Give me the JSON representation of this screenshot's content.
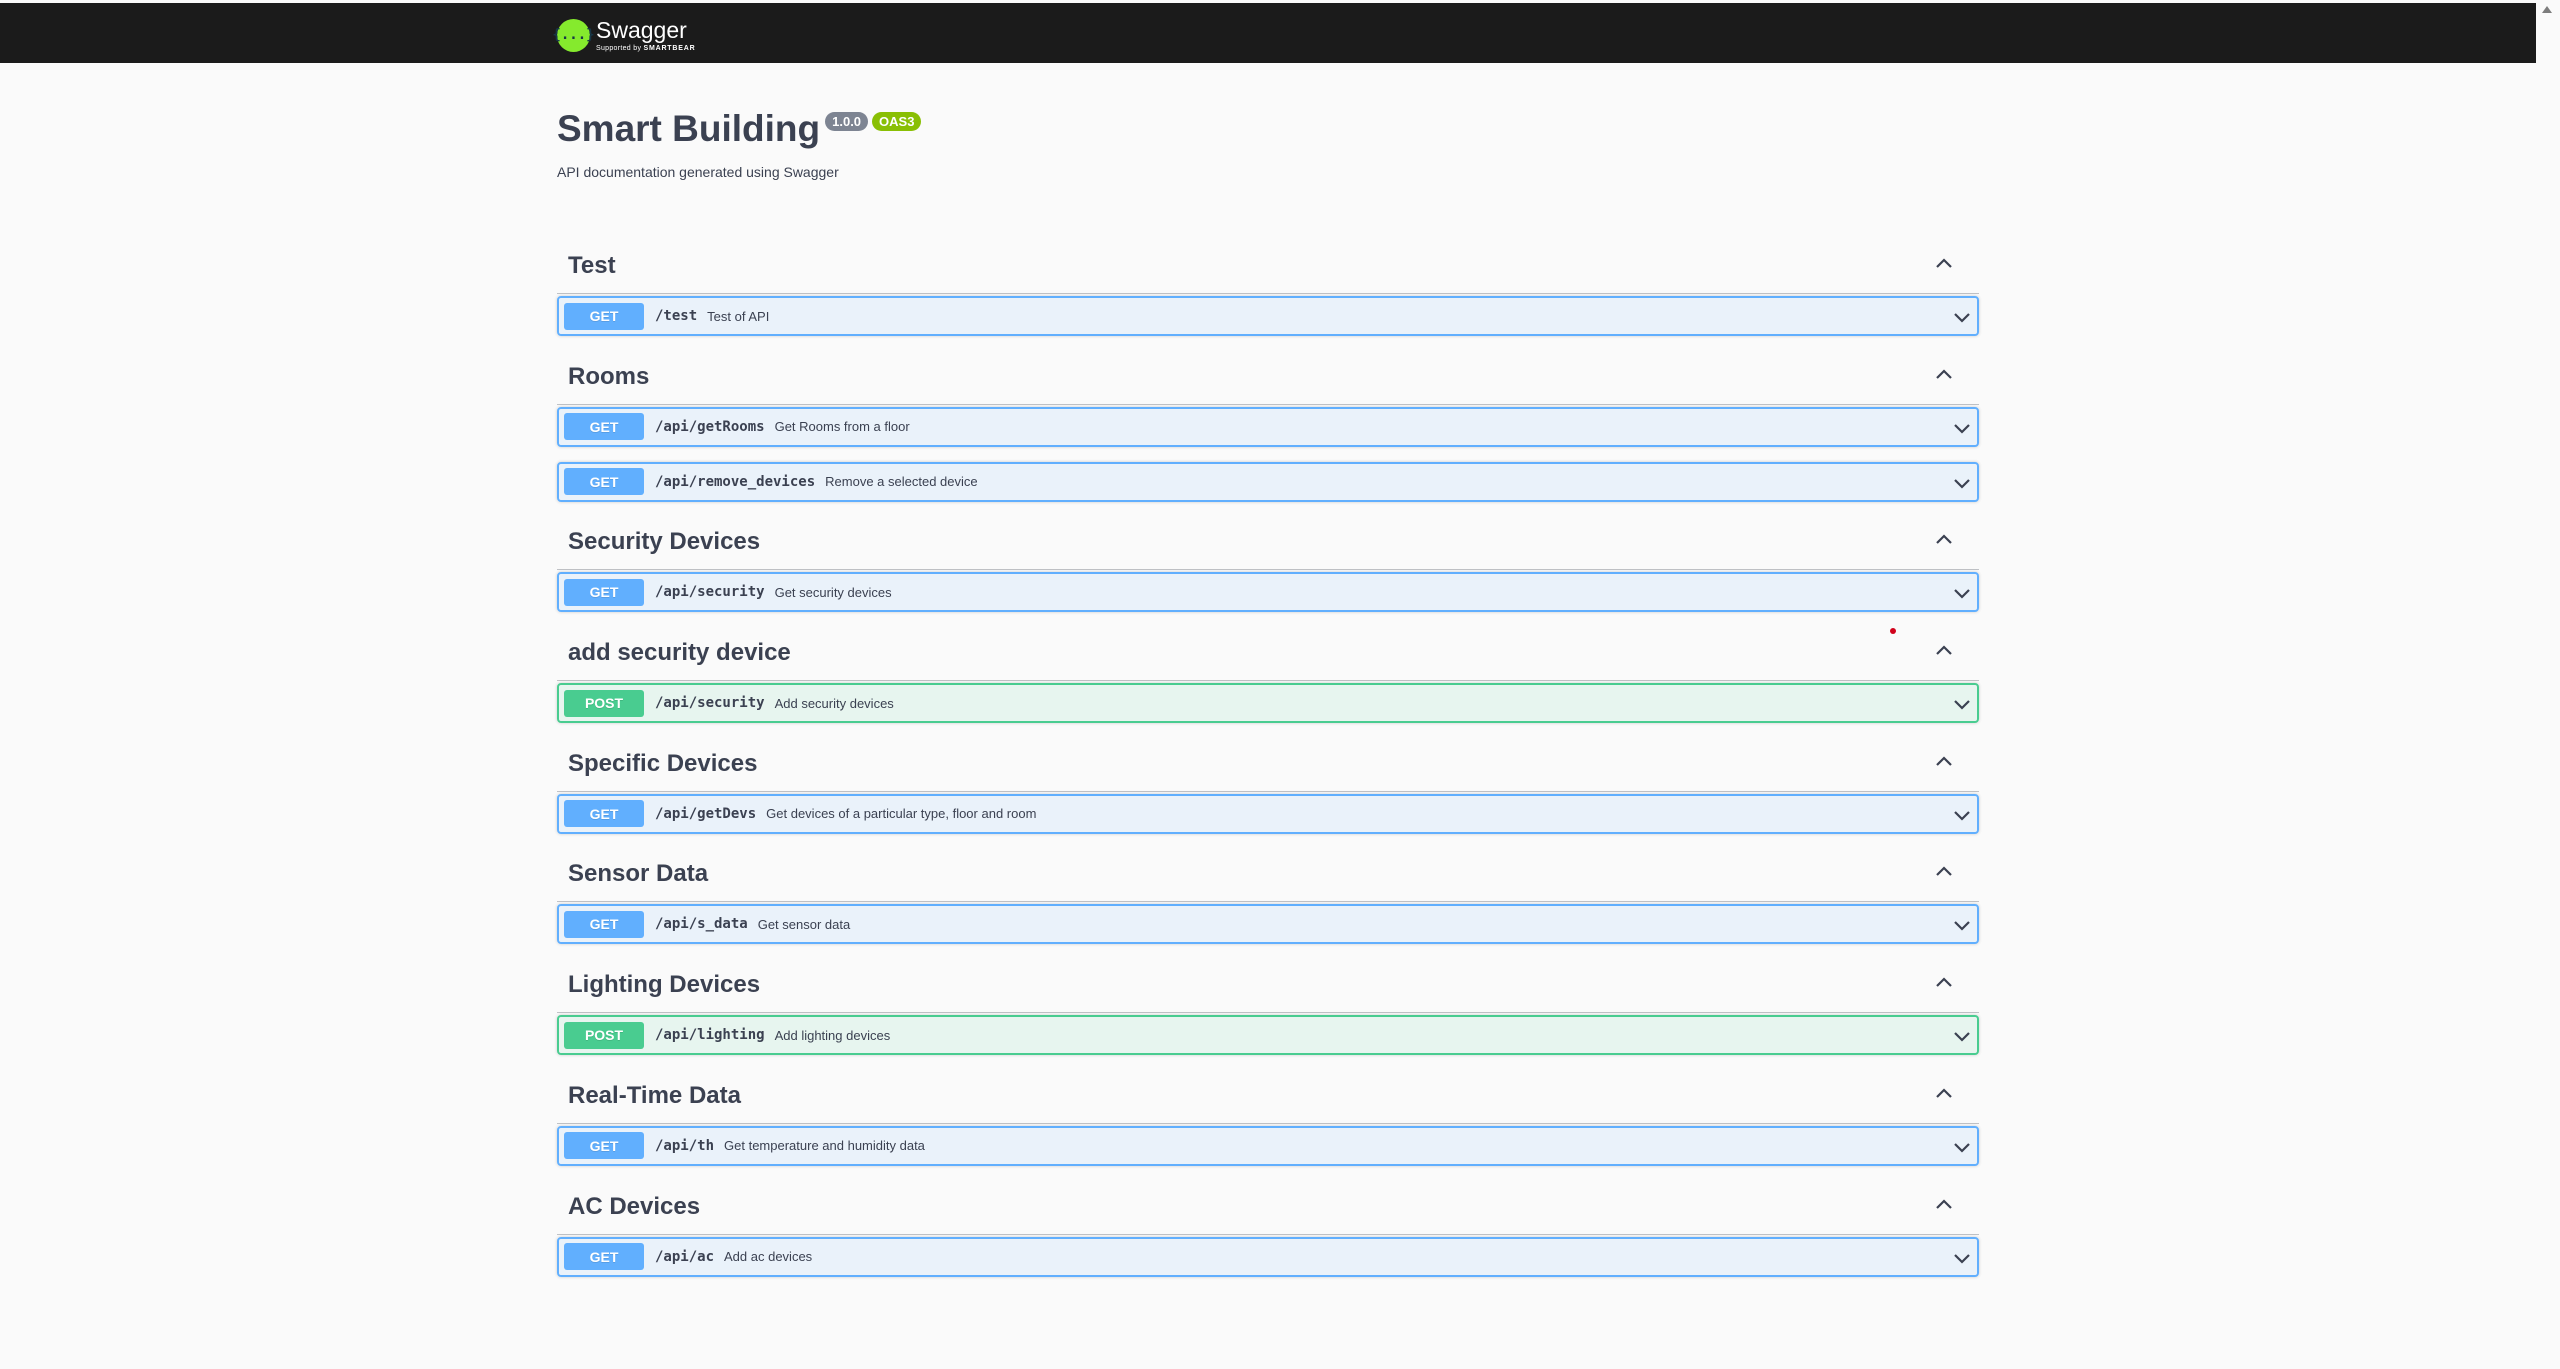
{
  "topbar": {
    "logo_icon": "{...}",
    "logo_name": "Swagger",
    "logo_sub_prefix": "Supported by",
    "logo_sub_brand": "SMARTBEAR"
  },
  "info": {
    "title": "Smart Building",
    "version": "1.0.0",
    "oas": "OAS3",
    "description": "API documentation generated using Swagger"
  },
  "colors": {
    "get": "#61affe",
    "post": "#49cc90",
    "topbar": "#1b1b1b",
    "logo": "#85ea2d"
  },
  "tags": [
    {
      "name": "Test",
      "ops": [
        {
          "method": "GET",
          "path": "/test",
          "summary": "Test of API"
        }
      ]
    },
    {
      "name": "Rooms",
      "ops": [
        {
          "method": "GET",
          "path": "/api/getRooms",
          "summary": "Get Rooms from a floor"
        },
        {
          "method": "GET",
          "path": "/api/remove_devices",
          "summary": "Remove a selected device"
        }
      ]
    },
    {
      "name": "Security Devices",
      "ops": [
        {
          "method": "GET",
          "path": "/api/security",
          "summary": "Get security devices"
        }
      ]
    },
    {
      "name": "add security device",
      "ops": [
        {
          "method": "POST",
          "path": "/api/security",
          "summary": "Add security devices"
        }
      ]
    },
    {
      "name": "Specific Devices",
      "ops": [
        {
          "method": "GET",
          "path": "/api/getDevs",
          "summary": "Get devices of a particular type, floor and room"
        }
      ]
    },
    {
      "name": "Sensor Data",
      "ops": [
        {
          "method": "GET",
          "path": "/api/s_data",
          "summary": "Get sensor data"
        }
      ]
    },
    {
      "name": "Lighting Devices",
      "ops": [
        {
          "method": "POST",
          "path": "/api/lighting",
          "summary": "Add lighting devices"
        }
      ]
    },
    {
      "name": "Real-Time Data",
      "ops": [
        {
          "method": "GET",
          "path": "/api/th",
          "summary": "Get temperature and humidity data"
        }
      ]
    },
    {
      "name": "AC Devices",
      "ops": [
        {
          "method": "GET",
          "path": "/api/ac",
          "summary": "Add ac devices"
        }
      ]
    }
  ]
}
